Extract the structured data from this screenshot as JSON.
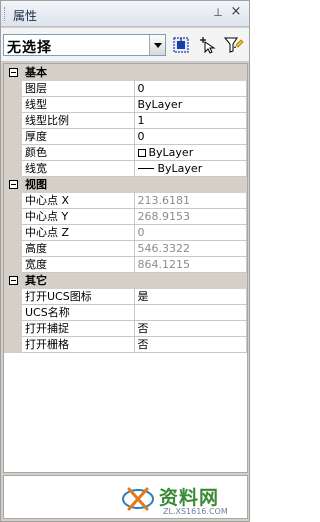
{
  "panel": {
    "title": "属性",
    "pin_glyph": "⊥",
    "close_glyph": "×"
  },
  "selection": {
    "value": "无选择"
  },
  "toolbar": {
    "icons": [
      "quick-select-icon",
      "pick-add-icon",
      "quick-select-filter-icon"
    ]
  },
  "categories": [
    {
      "name": "基本",
      "rows": [
        {
          "label": "图层",
          "value": "0"
        },
        {
          "label": "线型",
          "value": "ByLayer"
        },
        {
          "label": "线型比例",
          "value": "1"
        },
        {
          "label": "厚度",
          "value": "0"
        },
        {
          "label": "颜色",
          "value": "ByLayer"
        },
        {
          "label": "线宽",
          "value": "ByLayer"
        }
      ]
    },
    {
      "name": "视图",
      "rows": [
        {
          "label": "中心点 X",
          "value": "213.6181"
        },
        {
          "label": "中心点 Y",
          "value": "268.9153"
        },
        {
          "label": "中心点 Z",
          "value": "0"
        },
        {
          "label": "高度",
          "value": "546.3322"
        },
        {
          "label": "宽度",
          "value": "864.1215"
        }
      ]
    },
    {
      "name": "其它",
      "rows": [
        {
          "label": "打开UCS图标",
          "value": "是"
        },
        {
          "label": "UCS名称",
          "value": ""
        },
        {
          "label": "打开捕捉",
          "value": "否"
        },
        {
          "label": "打开栅格",
          "value": "否"
        }
      ]
    }
  ],
  "watermark": {
    "title": "资料网",
    "url": "ZL.XS1616.COM"
  },
  "colors": {
    "panel_bg": "#d4d0c8",
    "readonly_text": "#8c8c8c",
    "watermark_green": "#3a8a36"
  }
}
